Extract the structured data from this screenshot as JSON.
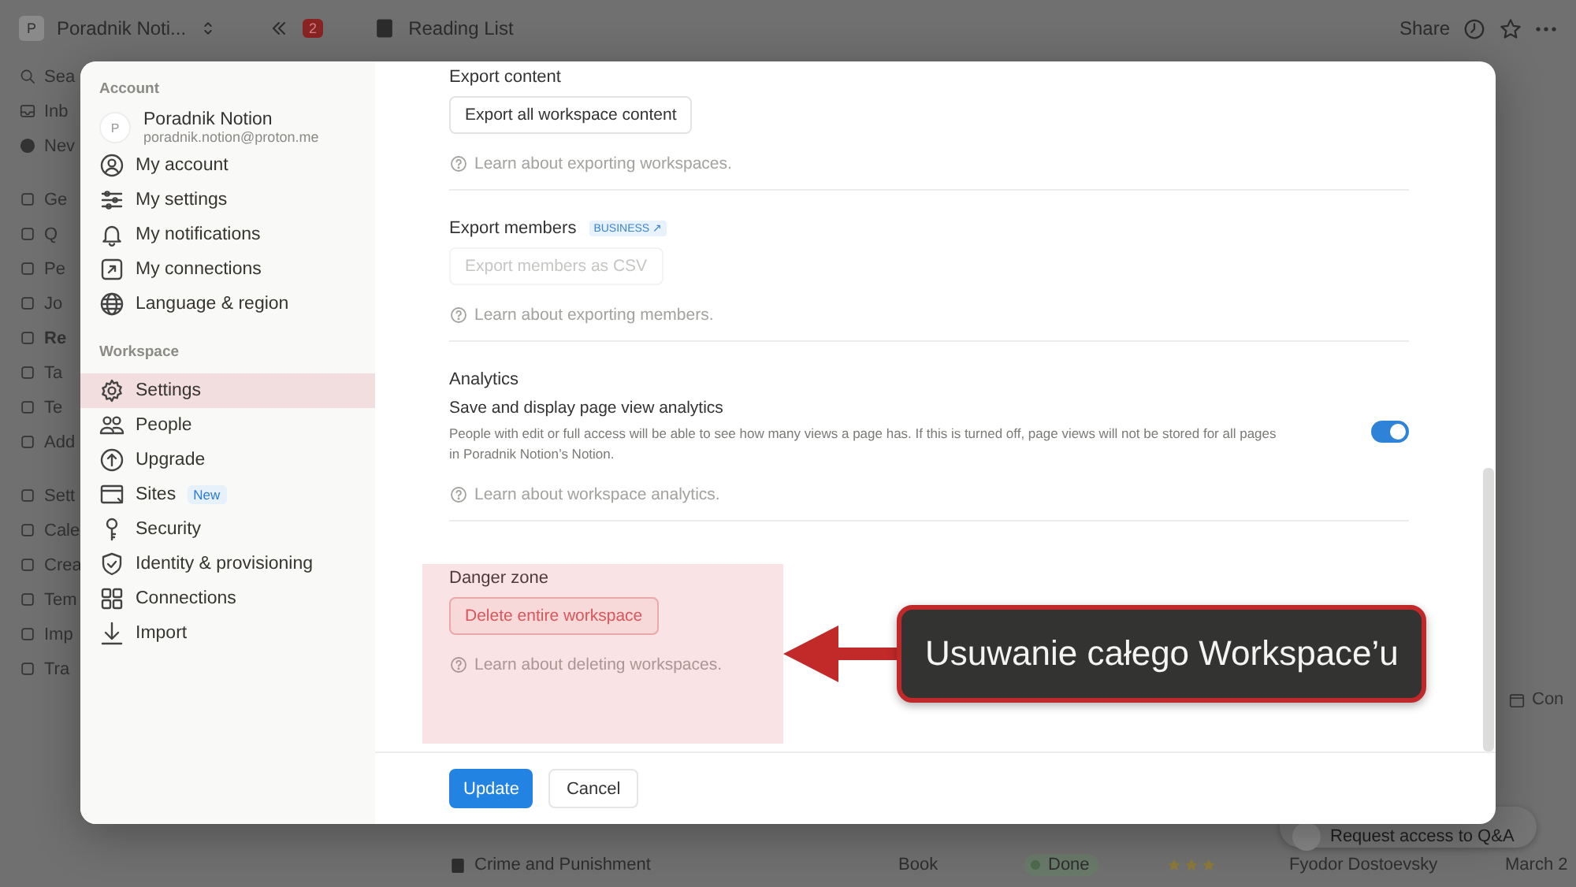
{
  "topbar": {
    "workspace_avatar": "P",
    "workspace": "Poradnik Noti...",
    "notification_count": "2",
    "page_title": "Reading List",
    "share": "Share"
  },
  "background_sidebar": [
    "Sea",
    "Inb",
    "Nev",
    "Ge",
    "Q",
    "Pe",
    "Jo",
    "Re",
    "Ta",
    "Te",
    "Add",
    "Sett",
    "Cale",
    "Crea",
    "Tem",
    "Imp",
    "Tra"
  ],
  "background_table": {
    "property": "Con",
    "rows": [
      {
        "title": "Crime and Punishment",
        "type": "Book",
        "status": "Done",
        "stars": 3,
        "author": "Fyodor Dostoevsky",
        "date": "March 2"
      }
    ],
    "request_access": "Request access to Q&A"
  },
  "settings": {
    "nav": [
      {
        "section": "Account",
        "user": {
          "avatar": "P",
          "name": "Poradnik Notion",
          "email": "poradnik.notion@proton.me"
        },
        "items": [
          {
            "label": "My account",
            "selected": false
          },
          {
            "label": "My settings",
            "selected": false
          },
          {
            "label": "My notifications",
            "selected": false
          },
          {
            "label": "My connections",
            "selected": false
          },
          {
            "label": "Language & region",
            "selected": false
          }
        ]
      },
      {
        "section": "Workspace",
        "items": [
          {
            "label": "Settings",
            "selected": true
          },
          {
            "label": "People",
            "selected": false
          },
          {
            "label": "Upgrade",
            "selected": false
          },
          {
            "label": "Sites",
            "selected": false,
            "badge": "New"
          },
          {
            "label": "Security",
            "selected": false
          },
          {
            "label": "Identity & provisioning",
            "selected": false
          },
          {
            "label": "Connections",
            "selected": false
          },
          {
            "label": "Import",
            "selected": false
          }
        ]
      }
    ],
    "sections": [
      {
        "title": "Export content",
        "button": "Export all workspace content",
        "button_disabled": false,
        "danger": false,
        "link": "Learn about exporting workspaces."
      },
      {
        "title": "Export members",
        "badge": "BUSINESS ↗",
        "button": "Export members as CSV",
        "button_disabled": true,
        "danger": false,
        "link": "Learn about exporting members."
      },
      {
        "title": "Analytics",
        "setting": {
          "label": "Save and display page view analytics",
          "description": "People with edit or full access will be able to see how many views a page has. If this is turned off, page views will not be stored for all pages in Poradnik Notion’s Notion.",
          "on": true
        },
        "danger": false,
        "link": "Learn about workspace analytics."
      },
      {
        "title": "Danger zone",
        "button": "Delete entire workspace",
        "button_disabled": false,
        "danger": true,
        "link": "Learn about deleting workspaces."
      }
    ],
    "footer": {
      "primary": "Update",
      "secondary": "Cancel"
    }
  },
  "annotation": {
    "callout": "Usuwanie całego Workspace’u"
  }
}
